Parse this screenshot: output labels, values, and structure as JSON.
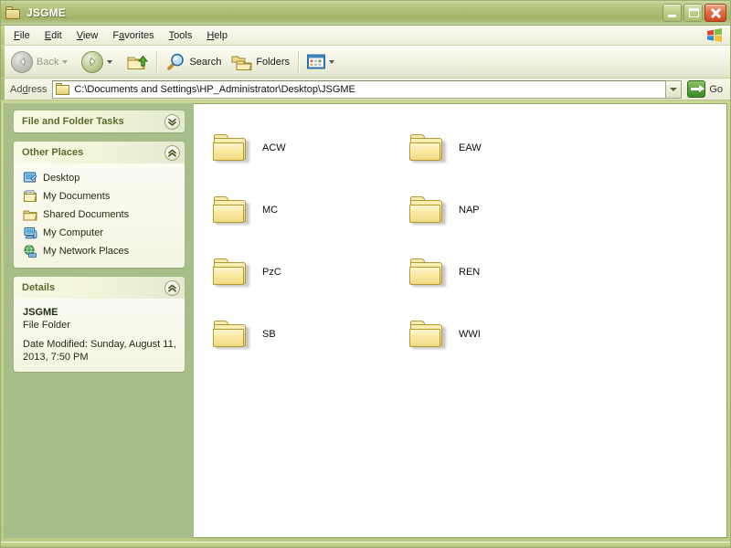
{
  "window": {
    "title": "JSGME",
    "title_icon": "folder-icon",
    "controls": {
      "minimize": "Minimize",
      "maximize": "Maximize",
      "close": "Close"
    }
  },
  "menubar": {
    "items": [
      {
        "label": "File",
        "accel_index": 0
      },
      {
        "label": "Edit",
        "accel_index": 0
      },
      {
        "label": "View",
        "accel_index": 0
      },
      {
        "label": "Favorites",
        "accel_index": 1
      },
      {
        "label": "Tools",
        "accel_index": 0
      },
      {
        "label": "Help",
        "accel_index": 0
      }
    ],
    "brand_icon": "windows-flag-icon"
  },
  "toolbar": {
    "back_label": "Back",
    "back_icon": "arrow-left-icon",
    "back_enabled": false,
    "forward_icon": "arrow-right-icon",
    "up_icon": "folder-up-icon",
    "search_label": "Search",
    "search_icon": "magnifier-icon",
    "folders_label": "Folders",
    "folders_icon": "folder-tree-icon",
    "views_icon": "views-grid-icon"
  },
  "address": {
    "label": "Address",
    "label_accel_index": 2,
    "icon": "folder-icon",
    "value": "C:\\Documents and Settings\\HP_Administrator\\Desktop\\JSGME",
    "placeholder": "",
    "dropdown_icon": "chevron-down-icon",
    "go_label": "Go",
    "go_icon": "green-arrow-icon"
  },
  "sidebar": {
    "panels": [
      {
        "id": "file-and-folder-tasks",
        "title": "File and Folder Tasks",
        "collapsed": true,
        "toggle_icon": "chevron-double-down-icon"
      },
      {
        "id": "other-places",
        "title": "Other Places",
        "collapsed": false,
        "toggle_icon": "chevron-double-up-icon",
        "items": [
          {
            "label": "Desktop",
            "icon": "desktop-icon"
          },
          {
            "label": "My Documents",
            "icon": "my-documents-icon"
          },
          {
            "label": "Shared Documents",
            "icon": "shared-documents-icon"
          },
          {
            "label": "My Computer",
            "icon": "my-computer-icon"
          },
          {
            "label": "My Network Places",
            "icon": "network-places-icon"
          }
        ]
      },
      {
        "id": "details",
        "title": "Details",
        "collapsed": false,
        "toggle_icon": "chevron-double-up-icon",
        "name": "JSGME",
        "type": "File Folder",
        "date_modified": "Date Modified: Sunday, August 11, 2013, 7:50 PM"
      }
    ]
  },
  "content": {
    "view_mode": "tiles",
    "folders": [
      {
        "name": "ACW",
        "icon": "folder-icon"
      },
      {
        "name": "EAW",
        "icon": "folder-icon"
      },
      {
        "name": "MC",
        "icon": "folder-icon"
      },
      {
        "name": "NAP",
        "icon": "folder-icon"
      },
      {
        "name": "PzC",
        "icon": "folder-icon"
      },
      {
        "name": "REN",
        "icon": "folder-icon"
      },
      {
        "name": "SB",
        "icon": "folder-icon"
      },
      {
        "name": "WWI",
        "icon": "folder-icon"
      }
    ]
  },
  "colors": {
    "titlebar_green": "#aebd74",
    "sidebar_green": "#a8be8a",
    "frame_green": "#bccb84",
    "panel_title_text": "#5a6b2e",
    "close_red": "#cf4b25",
    "go_green": "#5ca33f",
    "folder_yellow": "#f8e9a3"
  }
}
